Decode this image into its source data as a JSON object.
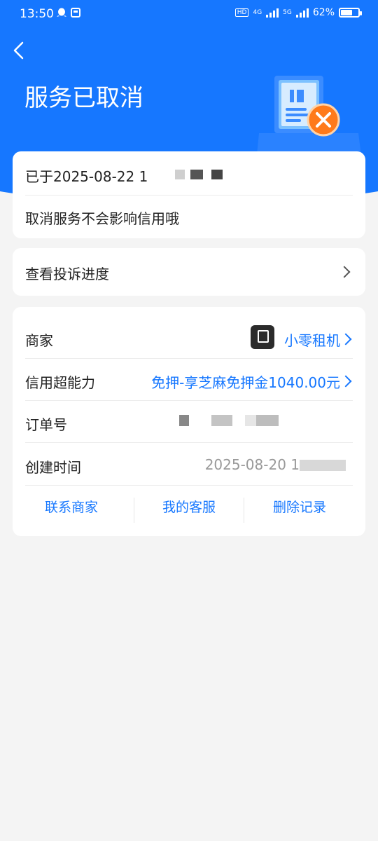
{
  "status_bar": {
    "time": "13:50",
    "hd_badge": "HD",
    "net1": "4G",
    "net2": "5G",
    "battery_text": "62%",
    "battery_level": 0.62
  },
  "header": {
    "title": "服务已取消",
    "colors": {
      "accent": "#1677ff",
      "warning": "#ff7a1a"
    }
  },
  "status_card": {
    "cancel_time": "已于2025-08-22 1",
    "note": "取消服务不会影响信用哦"
  },
  "complaint": {
    "label": "查看投诉进度"
  },
  "info": {
    "merchant_label": "商家",
    "merchant_name": "小零租机",
    "credit_label": "信用超能力",
    "credit_value": "免押-享芝麻免押金1040.00元",
    "order_label": "订单号",
    "created_label": "创建时间",
    "created_value": "2025-08-20 1"
  },
  "actions": {
    "contact": "联系商家",
    "service": "我的客服",
    "delete": "删除记录"
  }
}
